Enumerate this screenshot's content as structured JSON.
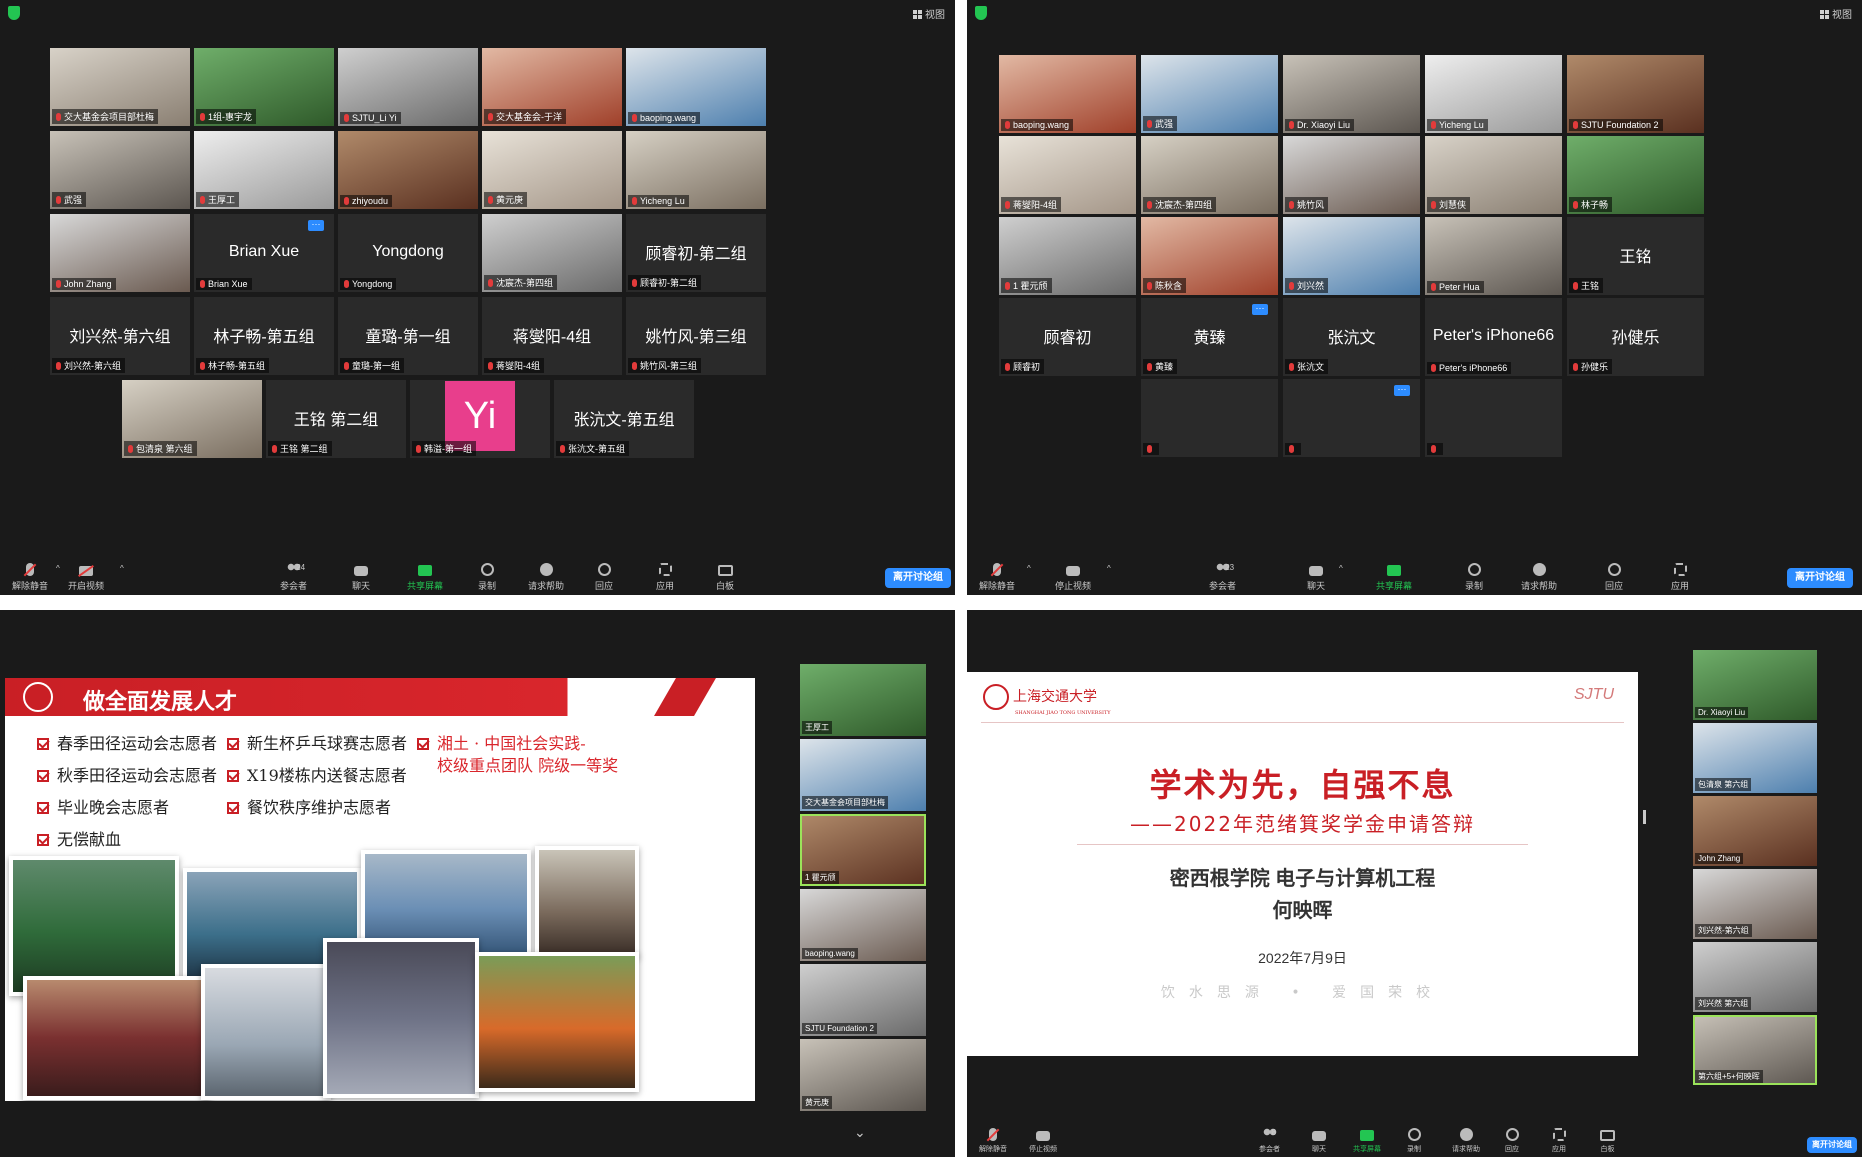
{
  "common": {
    "view_label": "视图",
    "toolbar": {
      "unmute": "解除静音",
      "start_video": "开启视频",
      "stop_video": "停止视频",
      "participants": "参会者",
      "chat": "聊天",
      "share": "共享屏幕",
      "record": "录制",
      "help": "请求帮助",
      "react": "回应",
      "apps": "应用",
      "whiteboard": "白板",
      "leave": "离开讨论组"
    },
    "colors": {
      "share_green": "#23c552",
      "leave_blue": "#2d8cff",
      "active_border": "#9be35a",
      "brand_red": "#c91f25"
    }
  },
  "q1": {
    "participant_count": "24",
    "tiles": [
      {
        "tag": "交大基金会项目部杜梅",
        "big": ""
      },
      {
        "tag": "1组-惠宇龙",
        "big": ""
      },
      {
        "tag": "SJTU_Li Yi",
        "big": ""
      },
      {
        "tag": "交大基金会-于洋",
        "big": ""
      },
      {
        "tag": "baoping.wang",
        "big": ""
      },
      {
        "tag": "武强",
        "big": ""
      },
      {
        "tag": "王厚工",
        "big": ""
      },
      {
        "tag": "zhiyoudu",
        "big": ""
      },
      {
        "tag": "黄元庚",
        "big": ""
      },
      {
        "tag": "Yicheng Lu",
        "big": ""
      },
      {
        "tag": "John Zhang",
        "big": ""
      },
      {
        "tag": "Brian Xue",
        "big": "Brian Xue"
      },
      {
        "tag": "Yongdong",
        "big": "Yongdong"
      },
      {
        "tag": "沈宸杰-第四组",
        "big": ""
      },
      {
        "tag": "顾睿初-第二组",
        "big": "顾睿初-第二组"
      },
      {
        "tag": "刘兴然-第六组",
        "big": "刘兴然-第六组"
      },
      {
        "tag": "林子畅-第五组",
        "big": "林子畅-第五组"
      },
      {
        "tag": "童璐-第一组",
        "big": "童璐-第一组"
      },
      {
        "tag": "蒋燮阳-4组",
        "big": "蒋燮阳-4组"
      },
      {
        "tag": "姚竹风-第三组",
        "big": "姚竹风-第三组"
      },
      {
        "tag": "包清泉 第六组",
        "big": ""
      },
      {
        "tag": "王铭 第二组",
        "big": "王铭 第二组"
      },
      {
        "tag": "韩溢-第一组",
        "big": "",
        "avatar": "Yi"
      },
      {
        "tag": "张沆文-第五组",
        "big": "张沆文-第五组"
      }
    ]
  },
  "q2": {
    "participant_count": "23",
    "tiles": [
      {
        "tag": "王厚工",
        "big": ""
      },
      {
        "tag": "交大基金会项目部杜梅",
        "big": ""
      },
      {
        "tag": "黄元庚",
        "big": ""
      },
      {
        "tag": "baoping.wang",
        "big": ""
      },
      {
        "tag": "武强",
        "big": ""
      },
      {
        "tag": "Dr. Xiaoyi Liu",
        "big": ""
      },
      {
        "tag": "Yicheng Lu",
        "big": ""
      },
      {
        "tag": "SJTU Foundation 2",
        "big": ""
      },
      {
        "tag": "蒋燮阳-4组",
        "big": ""
      },
      {
        "tag": "沈宸杰-第四组",
        "big": ""
      },
      {
        "tag": "姚竹风",
        "big": ""
      },
      {
        "tag": "刘慧侠",
        "big": ""
      },
      {
        "tag": "林子畅",
        "big": ""
      },
      {
        "tag": "1 瞿元颀",
        "big": ""
      },
      {
        "tag": "陈秋含",
        "big": "陈秋含"
      },
      {
        "tag": "刘兴然",
        "big": "刘兴然"
      },
      {
        "tag": "Peter Hua",
        "big": "Peter Hua"
      },
      {
        "tag": "王铭",
        "big": "王铭"
      },
      {
        "tag": "顾睿初",
        "big": "顾睿初"
      },
      {
        "tag": "黄臻",
        "big": "黄臻"
      },
      {
        "tag": "张沆文",
        "big": "张沆文"
      },
      {
        "tag": "Peter's iPhone66",
        "big": "Peter's iPhone66"
      },
      {
        "tag": "孙健乐",
        "big": "孙健乐"
      }
    ]
  },
  "q3": {
    "slide": {
      "title": "做全面发展人才",
      "bullets_left": [
        "春季田径运动会志愿者",
        "秋季田径运动会志愿者",
        "毕业晚会志愿者",
        "无偿献血"
      ],
      "bullets_mid": [
        "新生杯乒乓球赛志愿者",
        "X19楼栋内送餐志愿者",
        "餐饮秩序维护志愿者"
      ],
      "bullets_right": [
        "湘土 · 中国社会实践-",
        "校级重点团队 院级一等奖"
      ]
    },
    "side_tiles": [
      "王厚工",
      "交大基金会项目部杜梅",
      "1 瞿元颀",
      "baoping.wang",
      "SJTU Foundation 2",
      "黄元庚"
    ]
  },
  "q4": {
    "slide": {
      "logo": "上海交通大学",
      "logo_en": "SHANGHAI JIAO TONG UNIVERSITY",
      "sjtu_mark": "SJTU",
      "title": "学术为先，自强不息",
      "subtitle": "——2022年范绪箕奖学金申请答辩",
      "school": "密西根学院 电子与计算机工程",
      "name": "何映晖",
      "date": "2022年7月9日",
      "motto": "饮水思源 • 爱国荣校"
    },
    "participant_count": "8",
    "side_tiles": [
      "Dr. Xiaoyi Liu",
      "包清泉 第六组",
      "John Zhang",
      "刘兴然-第六组",
      "刘兴然 第六组",
      "第六组+5+何映晖"
    ]
  }
}
